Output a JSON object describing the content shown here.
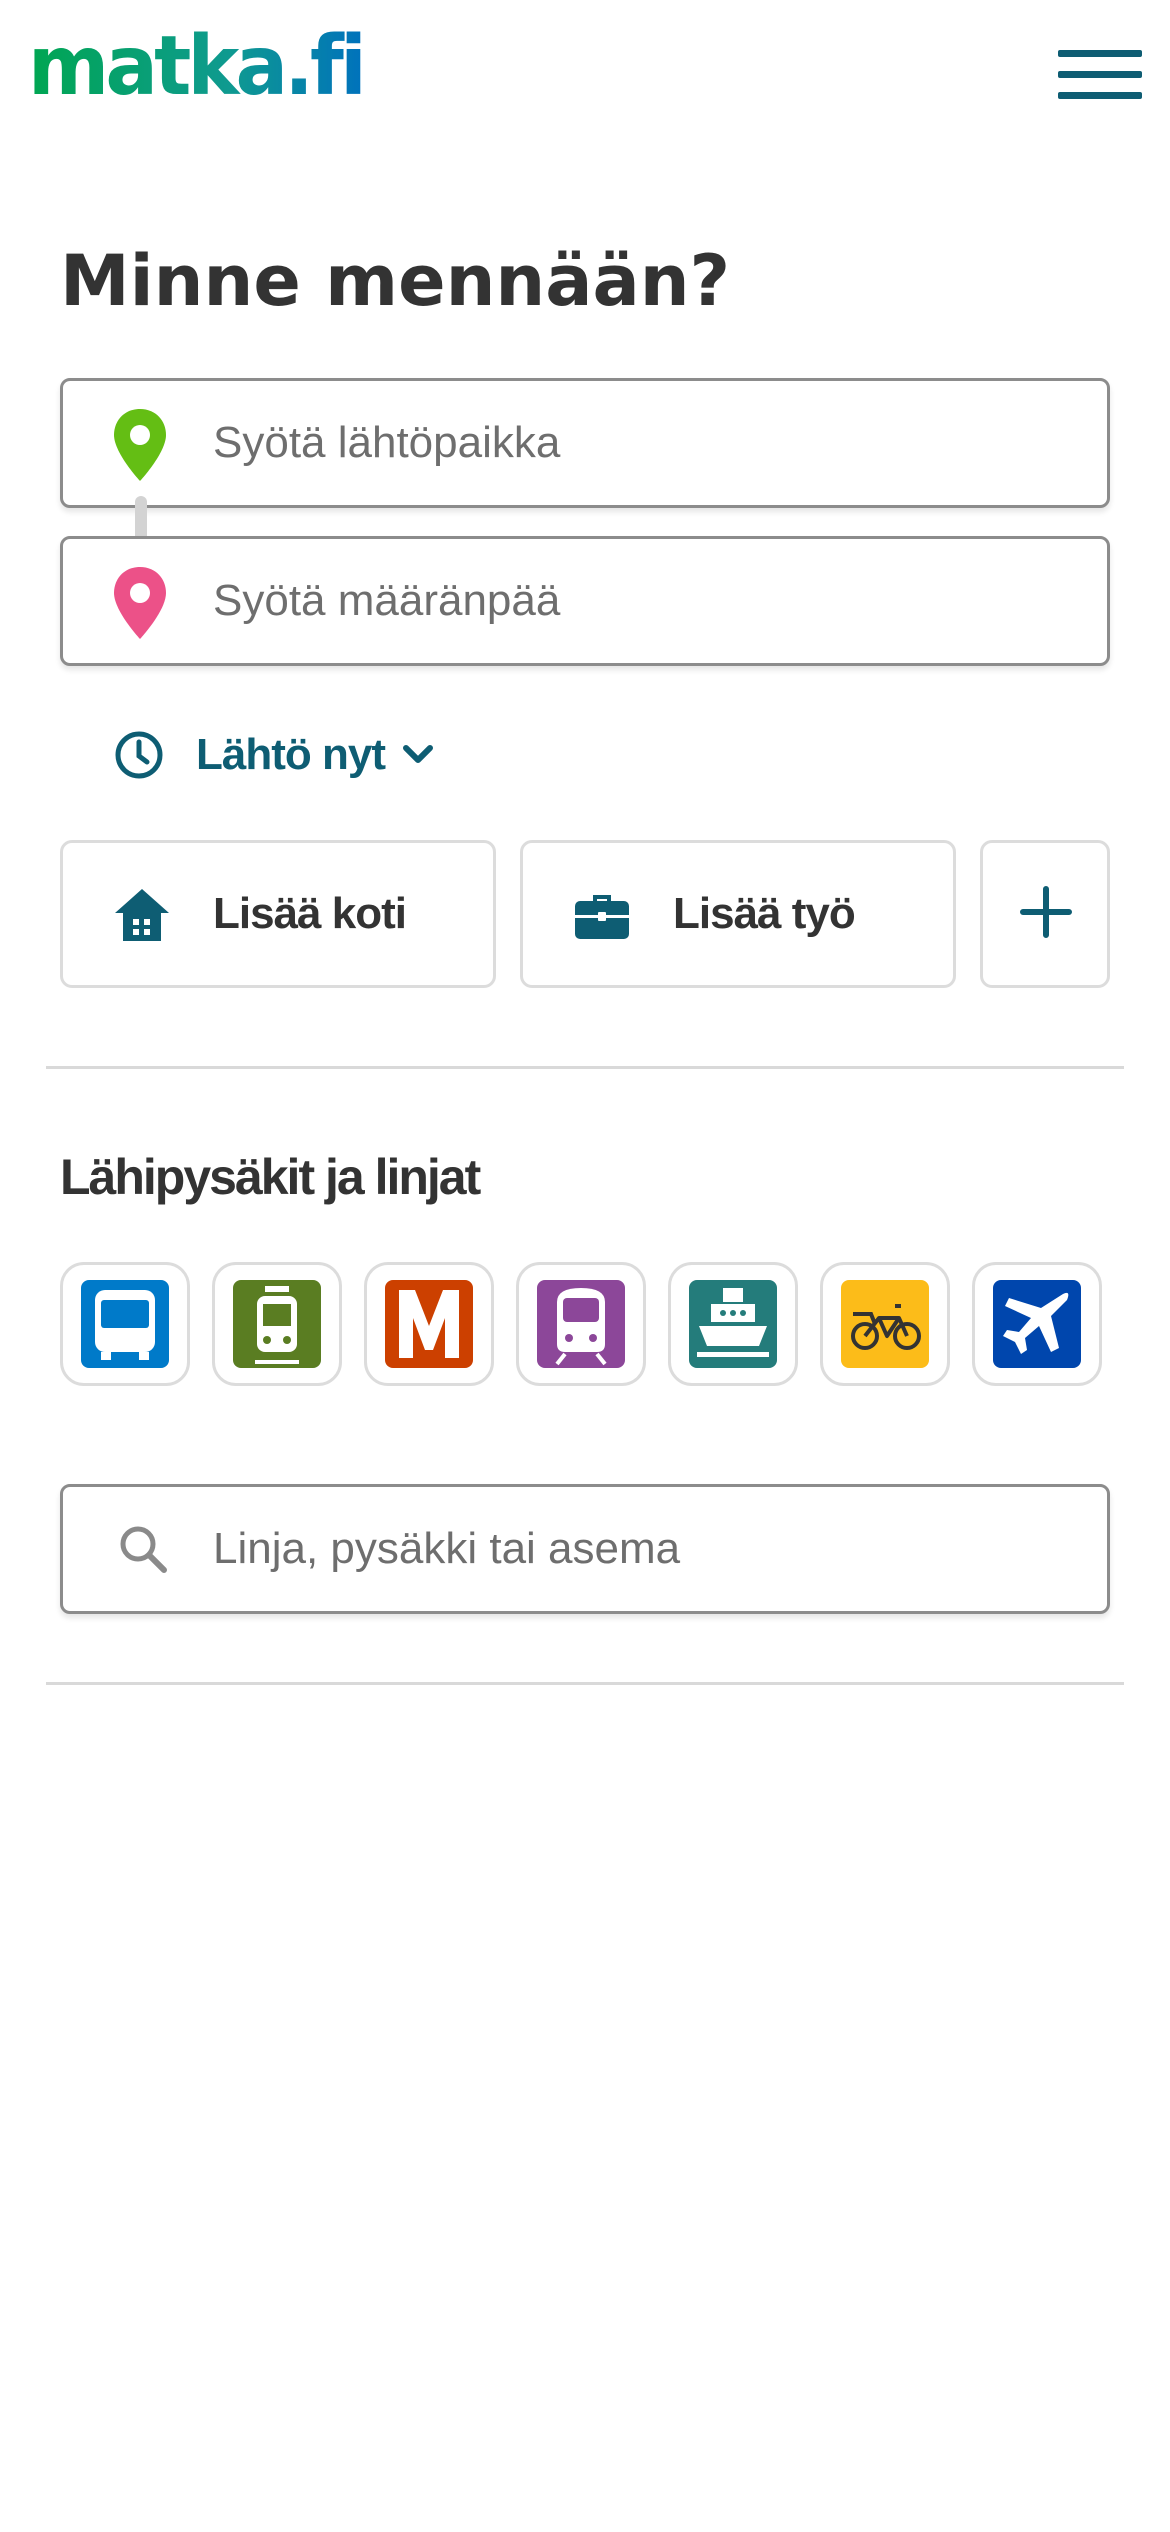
{
  "header": {
    "logo_text": "matka.fi",
    "menu_icon": "hamburger-icon"
  },
  "journey": {
    "title": "Minne mennään?",
    "origin_placeholder": "Syötä lähtöpaikka",
    "origin_value": "",
    "destination_placeholder": "Syötä määränpää",
    "destination_value": "",
    "time_label": "Lähtö nyt",
    "origin_icon": "map-pin-green-icon",
    "destination_icon": "map-pin-pink-icon"
  },
  "favourites": {
    "home_label": "Lisää koti",
    "work_label": "Lisää työ",
    "add_icon": "plus-icon"
  },
  "nearby": {
    "title": "Lähipysäkit ja linjat",
    "modes": [
      {
        "name": "bus",
        "icon": "bus-icon",
        "color": "#007ac9"
      },
      {
        "name": "tram",
        "icon": "tram-icon",
        "color": "#5a7d22"
      },
      {
        "name": "subway",
        "icon": "metro-icon",
        "color": "#cc4000"
      },
      {
        "name": "rail",
        "icon": "train-icon",
        "color": "#8c4799"
      },
      {
        "name": "ferry",
        "icon": "ferry-icon",
        "color": "#247c7b"
      },
      {
        "name": "citybike",
        "icon": "citybike-icon",
        "color": "#fcbc19"
      },
      {
        "name": "airplane",
        "icon": "airplane-icon",
        "color": "#0046ad"
      }
    ],
    "search_placeholder": "Linja, pysäkki tai asema",
    "search_value": ""
  },
  "colors": {
    "accent": "#0e5d73",
    "origin_pin": "#64be14",
    "destination_pin": "#ec5188",
    "logo_green": "#00a651",
    "logo_blue": "#0072bc"
  }
}
